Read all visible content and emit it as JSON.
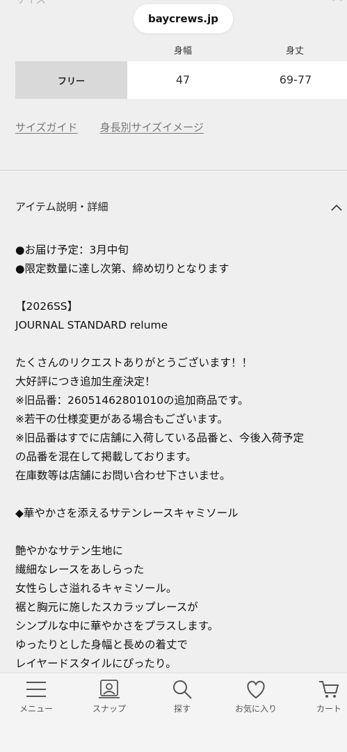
{
  "size_section": {
    "label": "サイズ",
    "columns": [
      "身幅",
      "身丈"
    ],
    "row": {
      "name": "フリー",
      "values": [
        "47",
        "69-77"
      ]
    }
  },
  "url_bar": {
    "domain": "baycrews.jp"
  },
  "links": {
    "size_guide": "サイズガイド",
    "height_size": "身長別サイズイメージ"
  },
  "item_section": {
    "title": "アイテム説明・詳細",
    "lines": [
      "●お届け予定：3月中旬",
      "●限定数量に達し次第、締め切りとなります",
      "",
      "【2026SS】",
      "JOURNAL STANDARD relume",
      "",
      "たくさんのリクエストありがとうございます！！",
      "大好評につき追加生産決定！",
      "※旧品番：26051462801010の追加商品です。",
      "※若干の仕様変更がある場合もございます。",
      "※旧品番はすでに店舗に入荷している品番と、今後入荷予定",
      "の品番を混在して掲載しております。",
      "在庫数等は店舗にお問い合わせ下さいませ。",
      "",
      "◆華やかさを添えるサテンレースキャミソール",
      "",
      "艶やかなサテン生地に",
      "繊細なレースをあしらった",
      "女性らしさ溢れるキャミソール。",
      "裾と胸元に施したスカラップレースが",
      "シンプルな中に華やかさをプラスします。",
      "ゆったりとした身幅と長めの着丈で",
      "レイヤードスタイルにぴったり。"
    ]
  },
  "bottom_nav": {
    "items": [
      {
        "label": "メニュー",
        "icon": "menu-icon"
      },
      {
        "label": "スナップ",
        "icon": "snap-icon"
      },
      {
        "label": "探す",
        "icon": "search-icon"
      },
      {
        "label": "お気に入り",
        "icon": "heart-icon"
      },
      {
        "label": "カート",
        "icon": "cart-icon"
      }
    ]
  }
}
